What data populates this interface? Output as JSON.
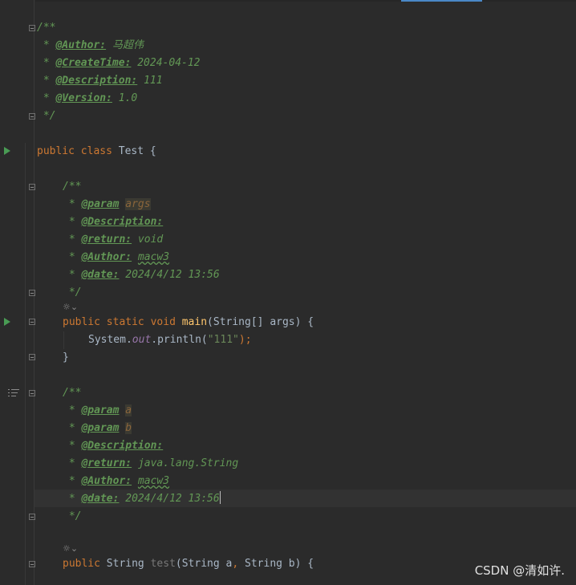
{
  "doc_header": {
    "open": "/**",
    "author_tag": "@Author:",
    "author": "马超伟",
    "createtime_tag": "@CreateTime:",
    "createtime": "2024-04-12",
    "description_tag": "@Description:",
    "description": "111",
    "version_tag": "@Version:",
    "version": "1.0",
    "close": "*/"
  },
  "class_line": {
    "kw1": "public",
    "kw2": "class",
    "name": "Test",
    "brace": "{"
  },
  "main_doc": {
    "open": "/**",
    "param_tag": "@param",
    "param_name": "args",
    "description_tag": "@Description:",
    "return_tag": "@return:",
    "return_value": "void",
    "author_tag": "@Author:",
    "author": "macw3",
    "date_tag": "@date:",
    "date": "2024/4/12 13:56",
    "close": "*/"
  },
  "main_method": {
    "kw1": "public",
    "kw2": "static",
    "kw3": "void",
    "name": "main",
    "params": "(String[] args) {",
    "body_obj": "System.",
    "body_field": "out",
    "body_call": ".println(",
    "body_str": "\"111\"",
    "body_end": ");",
    "close": "}"
  },
  "test_doc": {
    "open": "/**",
    "param_tag": "@param",
    "param_a": "a",
    "param_b": "b",
    "description_tag": "@Description:",
    "return_tag": "@return:",
    "return_value": "java.lang.String",
    "author_tag": "@Author:",
    "author": "macw3",
    "date_tag": "@date:",
    "date": "2024/4/12 13:56",
    "close": "*/"
  },
  "test_method": {
    "kw1": "public",
    "type": "String",
    "name": "test",
    "params_a": "(String a",
    "comma": ",",
    "params_b": " String b) {"
  },
  "inlay_hint": "☼⌄",
  "watermark": "CSDN @清如许."
}
